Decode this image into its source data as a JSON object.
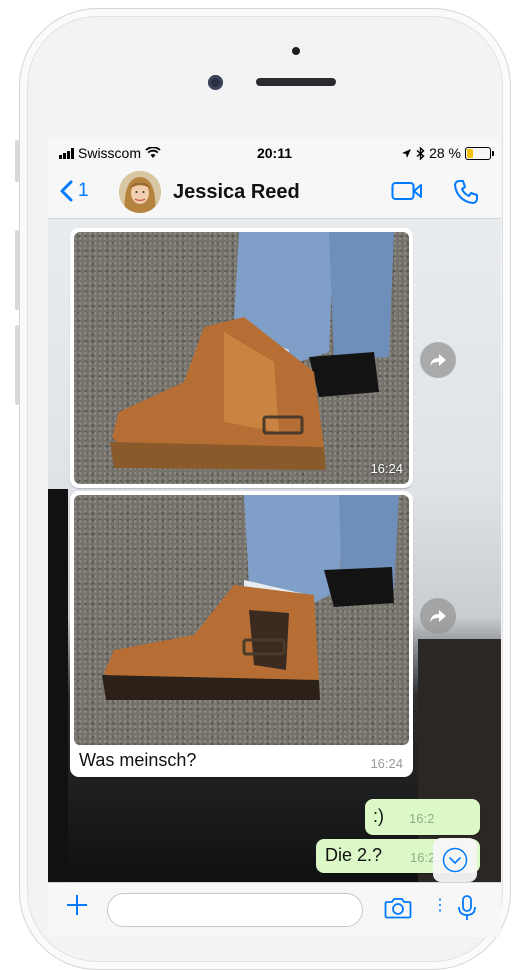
{
  "status_bar": {
    "carrier": "Swisscom",
    "time": "20:11",
    "battery_percent": "28 %",
    "battery_level": 0.28
  },
  "header": {
    "back_count": "1",
    "contact_name": "Jessica Reed"
  },
  "messages": [
    {
      "type": "image",
      "time": "16:24"
    },
    {
      "type": "image",
      "caption": "Was meinsch?",
      "time": "16:24"
    },
    {
      "type": "outgoing",
      "text": ":)",
      "time": "16:2"
    },
    {
      "type": "outgoing",
      "text": "Die 2.?",
      "time": "16:23"
    }
  ],
  "input": {
    "value": "",
    "placeholder": ""
  },
  "colors": {
    "accent": "#007aff",
    "outgoing_bubble": "#dcf8c6",
    "battery": "#f4c20d"
  },
  "icons": [
    "back-chevron-icon",
    "video-call-icon",
    "phone-icon",
    "forward-icon",
    "scroll-down-icon",
    "plus-icon",
    "camera-icon",
    "microphone-icon",
    "wifi-icon",
    "location-arrow-icon",
    "bluetooth-icon"
  ]
}
